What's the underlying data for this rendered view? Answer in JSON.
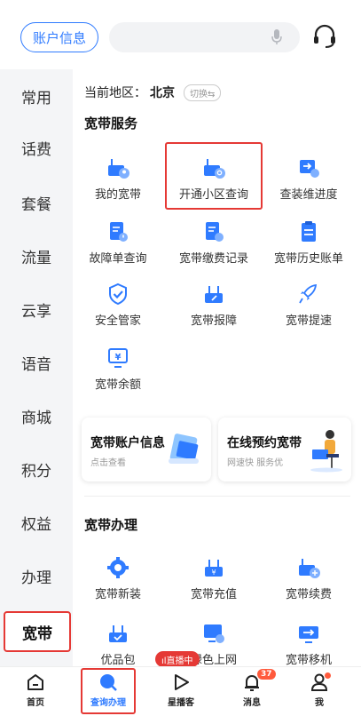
{
  "header": {
    "account_label": "账户信息"
  },
  "sidebar": {
    "items": [
      "常用",
      "话费",
      "套餐",
      "流量",
      "云享",
      "语音",
      "商城",
      "积分",
      "权益",
      "办理",
      "宽带"
    ]
  },
  "main": {
    "region_prefix": "当前地区：",
    "region": "北京",
    "switch_label": "切换⇆",
    "broadband_service_title": "宽带服务",
    "services": [
      "我的宽带",
      "开通小区查询",
      "查装维进度",
      "故障单查询",
      "宽带缴费记录",
      "宽带历史账单",
      "安全管家",
      "宽带报障",
      "宽带提速",
      "宽带余额"
    ],
    "card1": {
      "title": "宽带账户信息",
      "sub": "点击查看"
    },
    "card2": {
      "title": "在线预约宽带",
      "sub": "网速快 服务优"
    },
    "handle_title": "宽带办理",
    "handle_items": [
      "宽带新装",
      "宽带充值",
      "宽带续费",
      "优品包",
      "绿色上网",
      "宽带移机"
    ],
    "live_badge": "ıl直播中"
  },
  "tabbar": {
    "tabs": [
      "首页",
      "查询办理",
      "星播客",
      "消息",
      "我"
    ],
    "message_badge": "37"
  },
  "colors": {
    "accent": "#2f7bff",
    "highlight": "#e53935"
  }
}
